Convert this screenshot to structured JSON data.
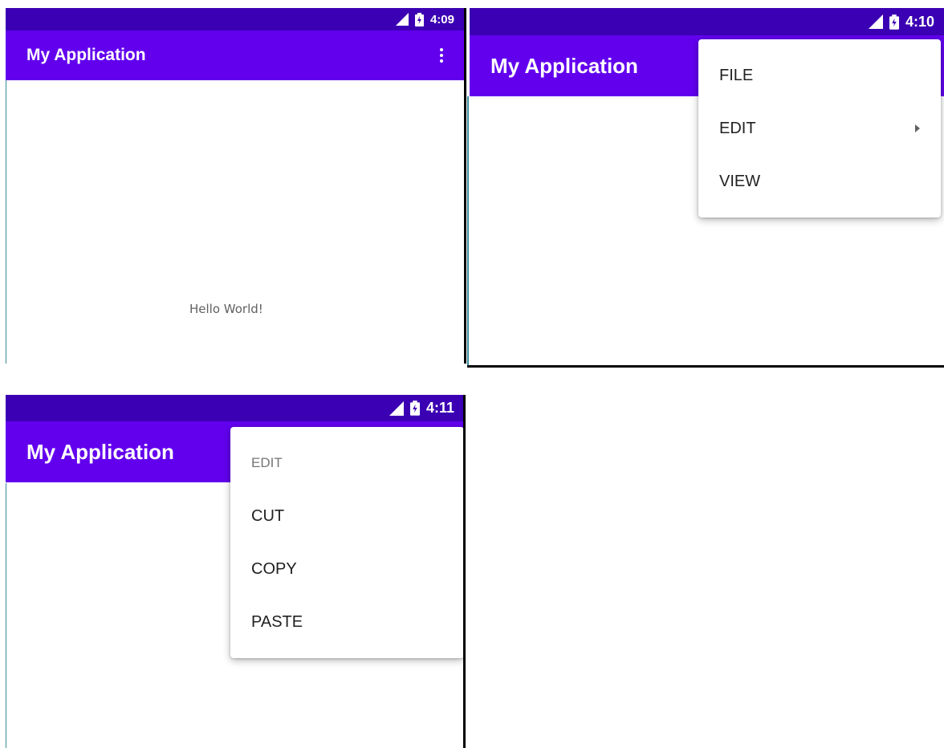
{
  "colors": {
    "status_bar": "#3b00b3",
    "app_bar": "#6200ee",
    "menu_bg": "#ffffff",
    "hello_text": "#616161"
  },
  "screen1": {
    "time": "4:09",
    "app_title": "My Application",
    "overflow_icon": "more-vert-icon",
    "hello": "Hello World!"
  },
  "screen2": {
    "time": "4:10",
    "app_title": "My Application",
    "menu": {
      "items": [
        {
          "label": "FILE"
        },
        {
          "label": "EDIT",
          "submenu_icon": "arrow-right-icon"
        },
        {
          "label": "VIEW"
        }
      ]
    }
  },
  "screen3": {
    "time": "4:11",
    "app_title": "My Application",
    "submenu": {
      "header": "EDIT",
      "items": [
        {
          "label": "CUT"
        },
        {
          "label": "COPY"
        },
        {
          "label": "PASTE"
        }
      ]
    }
  }
}
